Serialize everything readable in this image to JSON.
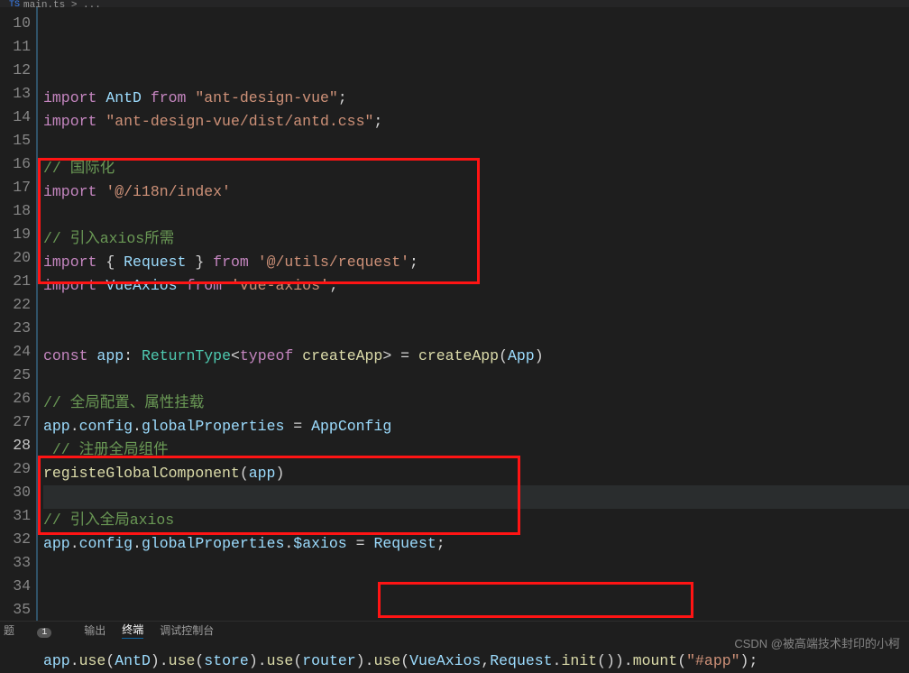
{
  "tab": {
    "filename": "main.ts",
    "crumb": "..."
  },
  "lineStart": 10,
  "lineEnd": 35,
  "currentLine": 28,
  "tokens": {
    "import": "import",
    "from": "from",
    "const": "const",
    "typeof": "typeof",
    "AntD": "AntD",
    "str_antdv": "\"ant-design-vue\"",
    "str_antdcss": "\"ant-design-vue/dist/antd.css\"",
    "cmt_i18n": "// 国际化",
    "str_i18n": "'@/i18n/index'",
    "cmt_axiosNeed": "// 引入axios所需",
    "Request": "Request",
    "str_req": "'@/utils/request'",
    "VueAxios": "VueAxios",
    "str_vueaxios": "'vue-axios'",
    "app": "app",
    "ReturnType": "ReturnType",
    "createApp": "createApp",
    "App": "App",
    "cmt_global": "// 全局配置、属性挂载",
    "config": "config",
    "globalProperties": "globalProperties",
    "AppConfig": "AppConfig",
    "cmt_regglob": "// 注册全局组件",
    "registeGlobalComponent": "registeGlobalComponent",
    "cmt_globaxios": "// 引入全局axios",
    "$axios": "$axios",
    "use": "use",
    "store": "store",
    "router": "router",
    "init": "init",
    "mount": "mount",
    "str_app": "\"#app\""
  },
  "status": {
    "problems": "题",
    "count": "1",
    "output": "输出",
    "terminal": "终端",
    "debug": "调试控制台"
  },
  "watermark": "CSDN @被高端技术封印的小柯"
}
